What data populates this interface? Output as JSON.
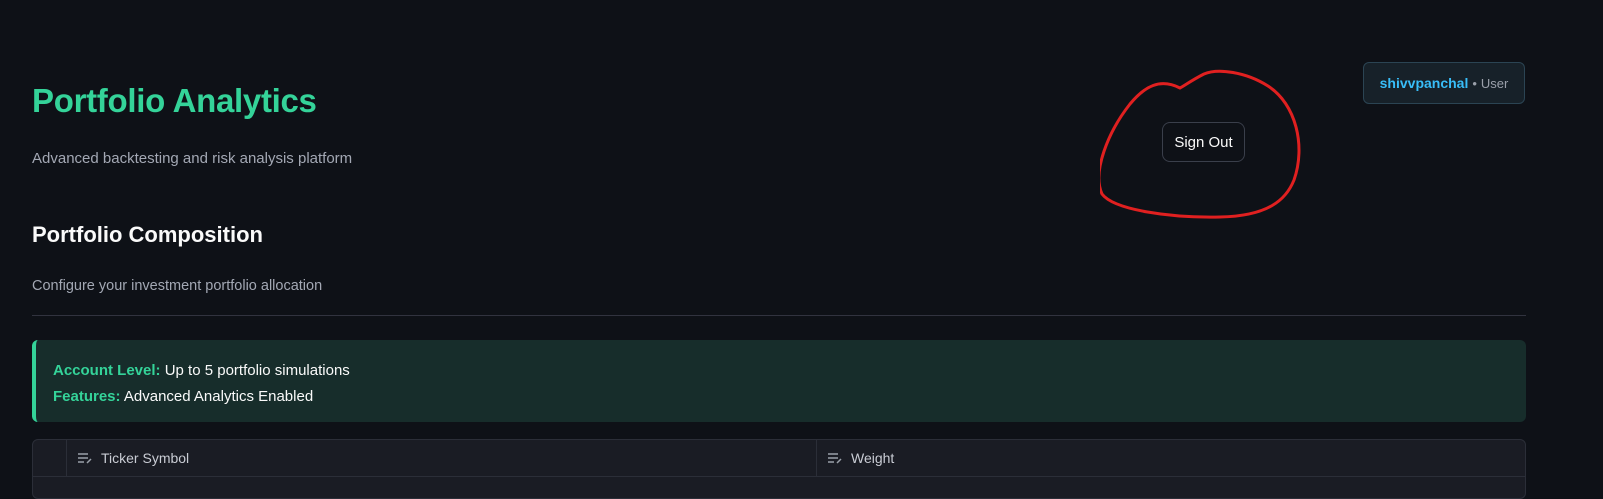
{
  "header": {
    "title": "Portfolio Analytics",
    "subtitle": "Advanced backtesting and risk analysis platform"
  },
  "user": {
    "name": "shivvpanchal",
    "separator": "•",
    "role": "User"
  },
  "sign_out_label": "Sign Out",
  "section": {
    "title": "Portfolio Composition",
    "caption": "Configure your investment portfolio allocation"
  },
  "info": {
    "account_level_key": "Account Level:",
    "account_level_value": "Up to 5 portfolio simulations",
    "features_key": "Features:",
    "features_value": "Advanced Analytics Enabled"
  },
  "table": {
    "columns": [
      {
        "label": "Ticker Symbol",
        "icon": "text-column-icon"
      },
      {
        "label": "Weight",
        "icon": "text-column-icon"
      }
    ]
  },
  "colors": {
    "accent": "#34d399",
    "user_name": "#38bdf8",
    "annotation": "#e02020",
    "background": "#0e1117"
  }
}
